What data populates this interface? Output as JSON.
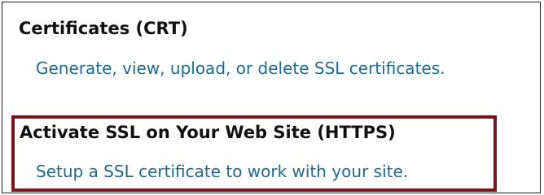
{
  "sections": [
    {
      "title": "Certificates (CRT)",
      "link": "Generate, view, upload, or delete SSL certificates."
    },
    {
      "title": "Activate SSL on Your Web Site (HTTPS)",
      "link": "Setup a SSL certificate to work with your site."
    }
  ],
  "colors": {
    "title": "#111111",
    "link": "#1f6a8a",
    "highlight_border": "#7a1418",
    "frame_border": "#1a1a1a"
  }
}
